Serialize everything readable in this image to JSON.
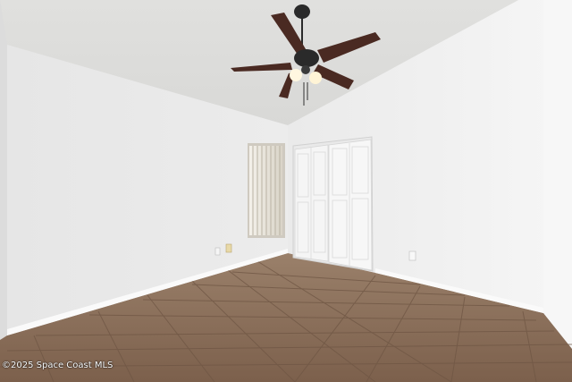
{
  "photo": {
    "subject": "empty bedroom with ceiling fan, window and double closet doors",
    "watermark": "©2025 Space Coast MLS"
  },
  "colors": {
    "ceiling": "#e2e2e0",
    "left_wall": "#e9e9e9",
    "right_wall": "#f0f0f0",
    "floor": "#8a6e58",
    "tile_line": "#6f5644",
    "fan_blade": "#4a2a22",
    "fan_metal": "#2a2a2a",
    "door": "#f5f5f5",
    "baseboard": "#fafafa"
  }
}
